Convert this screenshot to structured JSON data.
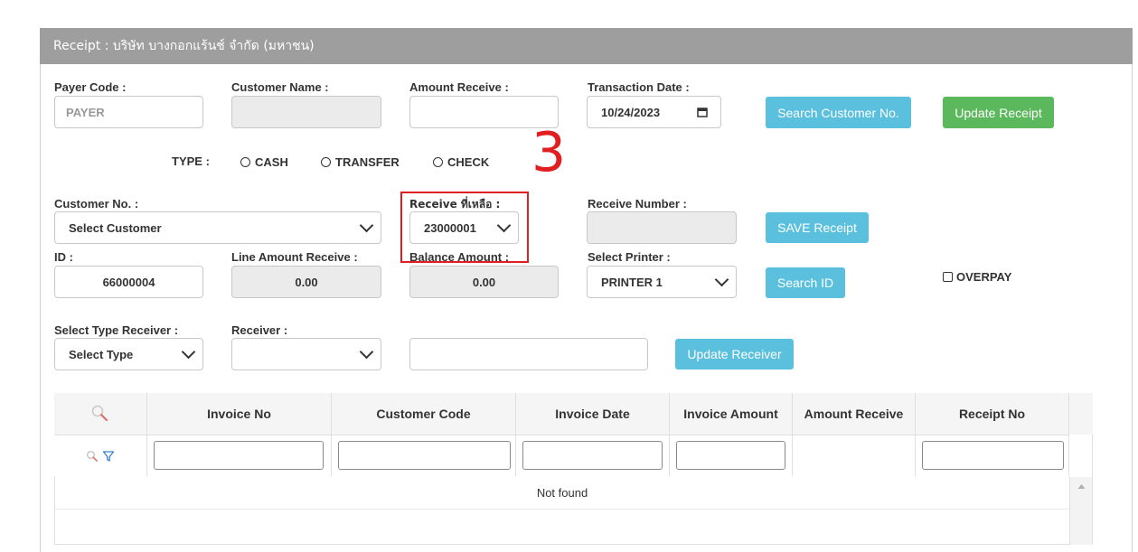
{
  "panel": {
    "title": "Receipt : บริษัท บางกอกแร้นช์ จำกัด (มหาชน)"
  },
  "form": {
    "payer_code": {
      "label": "Payer Code :",
      "placeholder": "PAYER"
    },
    "customer_name": {
      "label": "Customer Name :",
      "value": ""
    },
    "amount_receive": {
      "label": "Amount Receive :",
      "value": ""
    },
    "transaction_date": {
      "label": "Transaction Date :",
      "value": "10/24/2023"
    },
    "type": {
      "label": "TYPE :",
      "options": [
        "CASH",
        "TRANSFER",
        "CHECK"
      ]
    },
    "customer_no": {
      "label": "Customer No. :",
      "value": "Select Customer"
    },
    "receive_remaining": {
      "label": "Receive ที่เหลือ :",
      "value": "23000001"
    },
    "receive_number": {
      "label": "Receive Number :",
      "value": ""
    },
    "id": {
      "label": "ID :",
      "value": "66000004"
    },
    "line_amount_receive": {
      "label": "Line Amount Receive :",
      "value": "0.00"
    },
    "balance_amount": {
      "label": "Balance Amount :",
      "value": "0.00"
    },
    "select_printer": {
      "label": "Select Printer :",
      "value": "PRINTER 1"
    },
    "overpay": {
      "label": "OVERPAY"
    },
    "select_type_receiver": {
      "label": "Select Type Receiver :",
      "value": "Select Type"
    },
    "receiver": {
      "label": "Receiver :",
      "value": ""
    },
    "receiver_text": {
      "value": ""
    }
  },
  "buttons": {
    "search_customer": "Search Customer No.",
    "update_receipt": "Update Receipt",
    "save_receipt": "SAVE Receipt",
    "search_id": "Search ID",
    "update_receiver": "Update Receiver"
  },
  "annotation": {
    "step_number": "3",
    "color": "#e02020"
  },
  "table": {
    "columns": [
      "Invoice No",
      "Customer Code",
      "Invoice Date",
      "Invoice Amount",
      "Amount Receive",
      "Receipt No"
    ],
    "empty_text": "Not found"
  },
  "colors": {
    "header_bg": "#9e9e9e",
    "info_button": "#5bc0de",
    "success_button": "#5cb85c"
  }
}
